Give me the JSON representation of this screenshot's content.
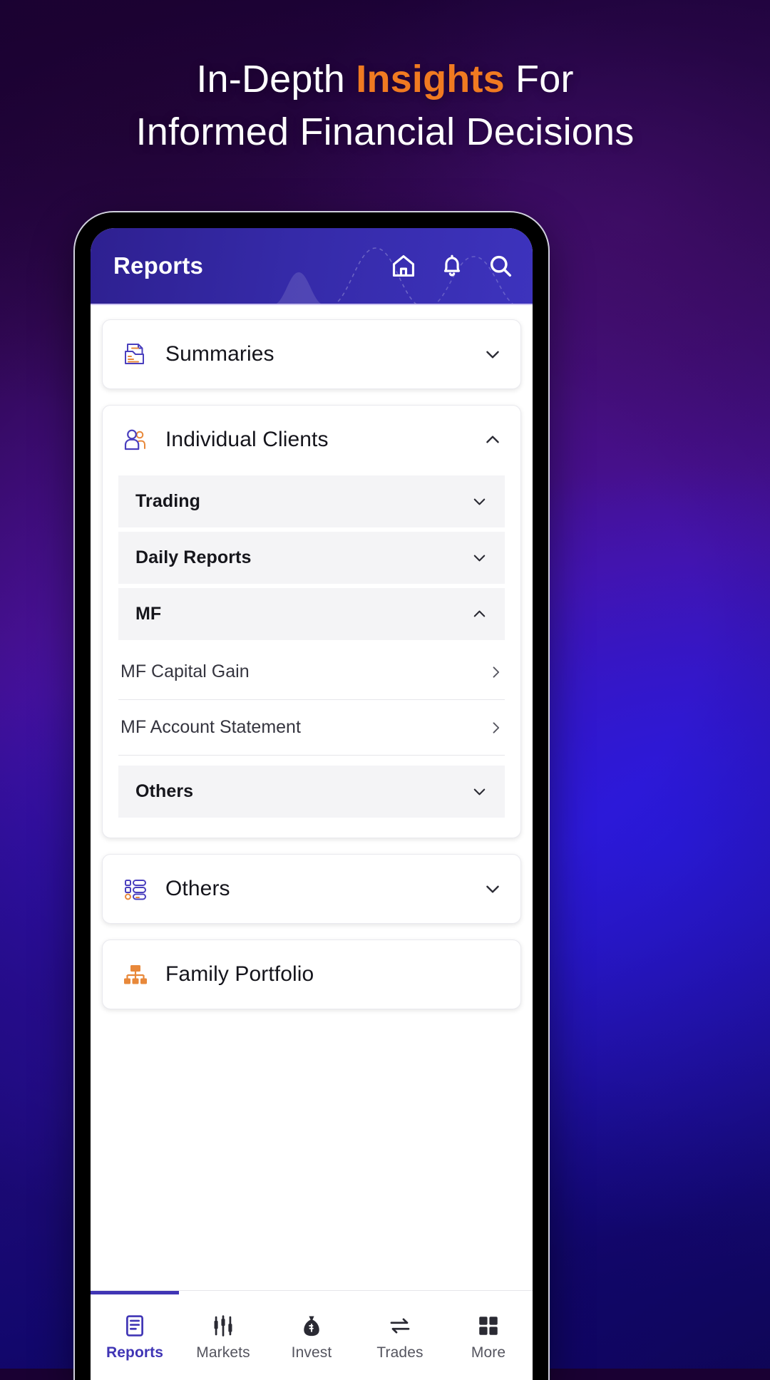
{
  "headline": {
    "line1_pre": "In-Depth ",
    "line1_highlight": "Insights",
    "line1_post": " For",
    "line2": "Informed Financial Decisions",
    "highlight_color": "#f07a21"
  },
  "app": {
    "header": {
      "title": "Reports",
      "actions": [
        {
          "name": "home-icon",
          "label": "Home"
        },
        {
          "name": "bell-icon",
          "label": "Notifications"
        },
        {
          "name": "search-icon",
          "label": "Search"
        }
      ],
      "bg_color": "#352aa8"
    },
    "sections": [
      {
        "id": "summaries",
        "label": "Summaries",
        "icon": "documents-folder-icon",
        "expanded": false,
        "chevron": "chevron-down"
      },
      {
        "id": "individual-clients",
        "label": "Individual Clients",
        "icon": "two-people-icon",
        "expanded": true,
        "chevron": "chevron-up",
        "subgroups": [
          {
            "id": "trading",
            "label": "Trading",
            "expanded": false,
            "chevron": "chevron-down"
          },
          {
            "id": "daily-reports",
            "label": "Daily Reports",
            "expanded": false,
            "chevron": "chevron-down"
          },
          {
            "id": "mf",
            "label": "MF",
            "expanded": true,
            "chevron": "chevron-up",
            "items": [
              {
                "id": "mf-capital-gain",
                "label": "MF Capital Gain",
                "arrow": "chevron-right"
              },
              {
                "id": "mf-account-statement",
                "label": "MF Account Statement",
                "arrow": "chevron-right"
              }
            ]
          },
          {
            "id": "others-sub",
            "label": "Others",
            "expanded": false,
            "chevron": "chevron-down"
          }
        ]
      },
      {
        "id": "others",
        "label": "Others",
        "icon": "list-grid-icon",
        "expanded": false,
        "chevron": "chevron-down"
      },
      {
        "id": "family-portfolio",
        "label": "Family Portfolio",
        "icon": "org-chart-icon",
        "expanded": false,
        "chevron": "none"
      }
    ],
    "bottom_nav": {
      "active": "Reports",
      "active_color": "#4035b5",
      "items": [
        {
          "id": "reports",
          "label": "Reports",
          "icon": "document-icon",
          "active": true
        },
        {
          "id": "markets",
          "label": "Markets",
          "icon": "candlestick-icon",
          "active": false
        },
        {
          "id": "invest",
          "label": "Invest",
          "icon": "money-bag-icon",
          "active": false
        },
        {
          "id": "trades",
          "label": "Trades",
          "icon": "exchange-arrows-icon",
          "active": false
        },
        {
          "id": "more",
          "label": "More",
          "icon": "grid-squares-icon",
          "active": false
        }
      ]
    }
  }
}
